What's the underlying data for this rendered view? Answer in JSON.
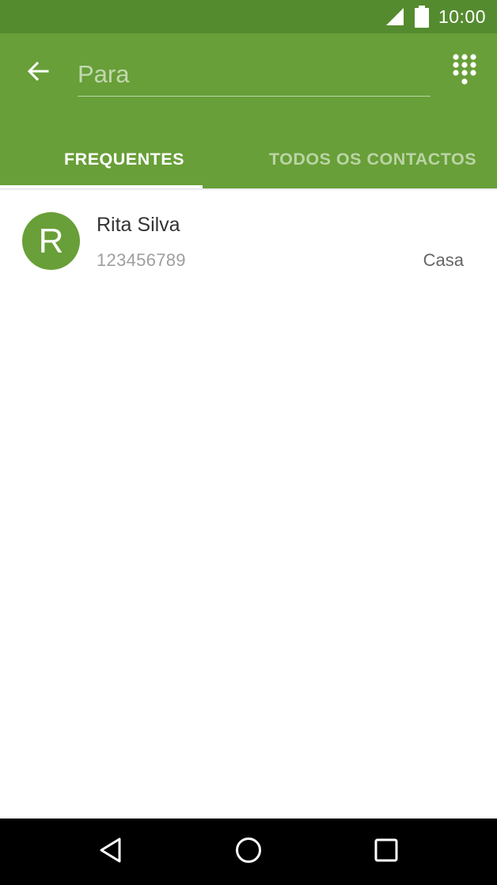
{
  "status_bar": {
    "time": "10:00",
    "icons": [
      "signal-icon",
      "battery-icon"
    ]
  },
  "app_bar": {
    "search": {
      "placeholder": "Para",
      "value": ""
    },
    "icons": {
      "back": "arrow-back-icon",
      "dialpad": "dialpad-icon"
    }
  },
  "tabs": [
    {
      "label": "FREQUENTES",
      "active": true
    },
    {
      "label": "TODOS OS CONTACTOS",
      "active": false
    }
  ],
  "contacts": [
    {
      "initial": "R",
      "name": "Rita Silva",
      "number": "123456789",
      "type": "Casa"
    }
  ],
  "nav_bar": {
    "icons": [
      "back-icon",
      "home-icon",
      "recents-icon"
    ]
  },
  "colors": {
    "status_bar": "#558b2f",
    "primary": "#689f38",
    "tab_inactive": "rgba(255,255,255,0.55)"
  }
}
